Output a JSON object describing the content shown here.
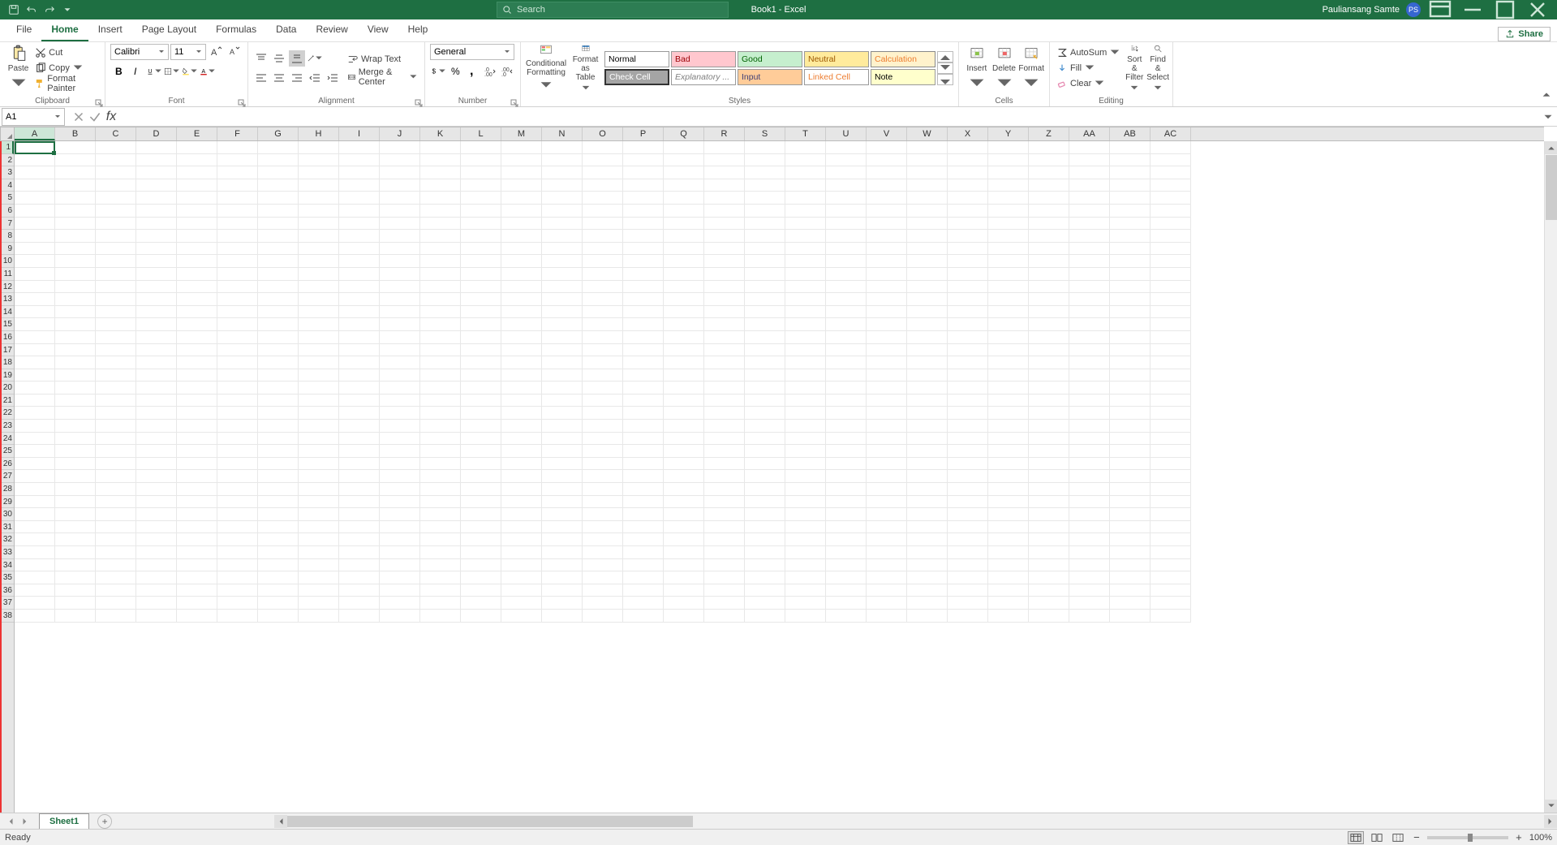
{
  "titlebar": {
    "doc_title": "Book1 - Excel",
    "search_placeholder": "Search",
    "user_name": "Pauliansang Samte",
    "user_initials": "PS"
  },
  "tabs": {
    "file": "File",
    "home": "Home",
    "insert": "Insert",
    "page_layout": "Page Layout",
    "formulas": "Formulas",
    "data": "Data",
    "review": "Review",
    "view": "View",
    "help": "Help",
    "share": "Share"
  },
  "ribbon": {
    "clipboard": {
      "label": "Clipboard",
      "paste": "Paste",
      "cut": "Cut",
      "copy": "Copy",
      "format_painter": "Format Painter"
    },
    "font": {
      "label": "Font",
      "name": "Calibri",
      "size": "11"
    },
    "alignment": {
      "label": "Alignment",
      "wrap": "Wrap Text",
      "merge": "Merge & Center"
    },
    "number": {
      "label": "Number",
      "format": "General"
    },
    "styles": {
      "label": "Styles",
      "cond_fmt": "Conditional\nFormatting",
      "fmt_table": "Format as\nTable",
      "normal": "Normal",
      "bad": "Bad",
      "good": "Good",
      "neutral": "Neutral",
      "calculation": "Calculation",
      "check_cell": "Check Cell",
      "explanatory": "Explanatory ...",
      "input": "Input",
      "linked_cell": "Linked Cell",
      "note": "Note"
    },
    "cells": {
      "label": "Cells",
      "insert": "Insert",
      "delete": "Delete",
      "format": "Format"
    },
    "editing": {
      "label": "Editing",
      "autosum": "AutoSum",
      "fill": "Fill",
      "clear": "Clear",
      "sort_filter": "Sort &\nFilter",
      "find_select": "Find &\nSelect"
    }
  },
  "formula_bar": {
    "name_box": "A1",
    "fx": "fx"
  },
  "grid": {
    "columns": [
      "A",
      "B",
      "C",
      "D",
      "E",
      "F",
      "G",
      "H",
      "I",
      "J",
      "K",
      "L",
      "M",
      "N",
      "O",
      "P",
      "Q",
      "R",
      "S",
      "T",
      "U",
      "V",
      "W",
      "X",
      "Y",
      "Z",
      "AA",
      "AB",
      "AC"
    ],
    "row_count": 38,
    "active_cell": "A1"
  },
  "sheet_tabs": {
    "sheet1": "Sheet1"
  },
  "statusbar": {
    "ready": "Ready",
    "zoom": "100%"
  }
}
